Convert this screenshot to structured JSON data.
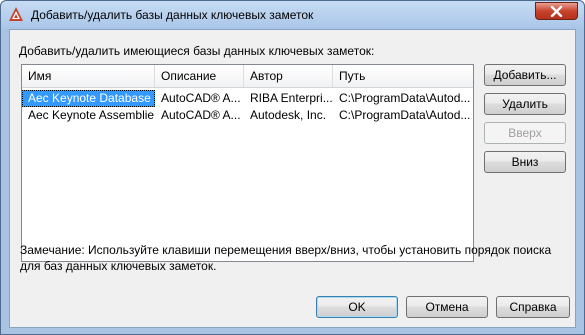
{
  "window": {
    "title": "Добавить/удалить базы данных ключевых заметок",
    "accent_color": "#c7432b"
  },
  "section_label": "Добавить/удалить имеющиеся базы данных ключевых заметок:",
  "table": {
    "columns": [
      "Имя",
      "Описание",
      "Автор",
      "Путь"
    ],
    "rows": [
      [
        "Aec Keynote Database ...",
        "AutoCAD® A...",
        "RIBA Enterpri...",
        "C:\\ProgramData\\Autod..."
      ],
      [
        "Aec Keynote Assemblie...",
        "AutoCAD® A...",
        "Autodesk, Inc.",
        "C:\\ProgramData\\Autod..."
      ]
    ],
    "selected_row": 0
  },
  "buttons": {
    "add": "Добавить...",
    "remove": "Удалить",
    "up": "Вверх",
    "down": "Вниз",
    "ok": "OK",
    "cancel": "Отмена",
    "help": "Справка"
  },
  "note": "Замечание: Используйте клавиши перемещения вверх/вниз, чтобы установить порядок поиска для баз данных ключевых заметок."
}
